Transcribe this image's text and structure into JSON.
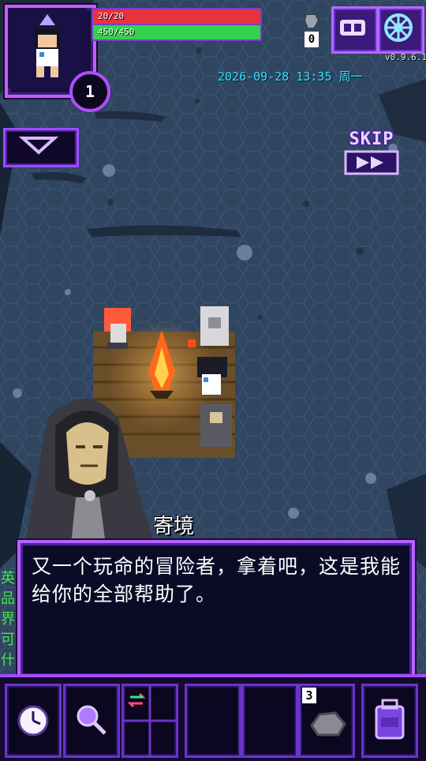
{
  "player": {
    "level": "1",
    "hp_text": "20/20",
    "hp_fraction": 1.0,
    "mp_text": "450/450",
    "mp_fraction": 1.0,
    "avatar": "player-portrait"
  },
  "keys": {
    "icon": "key-icon",
    "count": "0"
  },
  "menu": {
    "icons": [
      "vr-goggles-icon",
      "settings-wheel-icon"
    ]
  },
  "version": "v0.9.6.1",
  "datetime": "2026-09-28 13:35 周一",
  "dropdown": {
    "icon": "chevron-down-icon"
  },
  "skip": {
    "label": "SKIP",
    "icon": "fast-forward-icon"
  },
  "dialog": {
    "speaker": "寄境",
    "text": "又一个玩命的冒险者，拿着吧，这是我能给你的全部帮助了。"
  },
  "side_text": "英品界可什",
  "hotbar": {
    "slots": [
      {
        "icon": "clock-icon"
      },
      {
        "icon": "magnifier-icon"
      },
      {
        "icon": "swap-grid-icon"
      },
      {
        "icon": "empty-slot"
      },
      {
        "icon": "empty-slot"
      },
      {
        "icon": "stone-icon",
        "count": "3"
      },
      {
        "icon": "backpack-icon"
      }
    ]
  },
  "colors": {
    "accent": "#b563ff",
    "hp": "#e8323c",
    "mp": "#34d24a",
    "datetime": "#35e3ff",
    "ground": "#2f4460"
  }
}
